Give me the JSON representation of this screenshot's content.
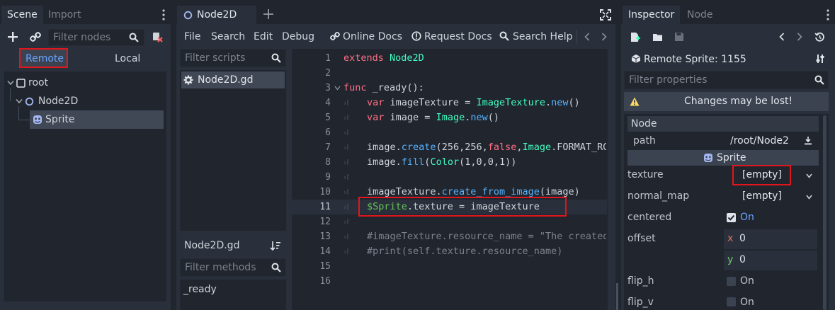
{
  "scene_dock": {
    "tabs": [
      "Scene",
      "Import"
    ],
    "filter_placeholder": "Filter nodes",
    "remote_label": "Remote",
    "local_label": "Local",
    "tree": [
      {
        "label": "root"
      },
      {
        "label": "Node2D"
      },
      {
        "label": "Sprite"
      }
    ]
  },
  "editor": {
    "tab_label": "Node2D",
    "menu": [
      "File",
      "Search",
      "Edit",
      "Debug",
      "Online Docs",
      "Request Docs",
      "Search Help"
    ],
    "filter_scripts_placeholder": "Filter scripts",
    "script_list": [
      "Node2D.gd"
    ],
    "current_script": "Node2D.gd",
    "filter_methods_placeholder": "Filter methods",
    "methods": [
      "_ready"
    ],
    "line_numbers": [
      "1",
      "2",
      "3",
      "4",
      "5",
      "6",
      "7",
      "8",
      "9",
      "10",
      "11",
      "12",
      "13",
      "14",
      "15",
      "16"
    ],
    "code": {
      "l1_kw": "extends",
      "l1_ty": "Node2D",
      "l3_kw": "func",
      "l3_rest": "_ready():",
      "l4_kw": "var",
      "l4_a": "imageTexture = ",
      "l4_ty": "ImageTexture",
      "l4_dot": ".",
      "l4_fn": "new",
      "l4_end": "()",
      "l5_kw": "var",
      "l5_a": "image = ",
      "l5_ty": "Image",
      "l5_dot": ".",
      "l5_fn": "new",
      "l5_end": "()",
      "l7_a": "image.",
      "l7_fn": "create",
      "l7_b": "(256,256,",
      "l7_kw": "false",
      "l7_c": ",",
      "l7_ty": "Image",
      "l7_d": ".FORMAT_RG",
      "l8_a": "image.",
      "l8_fn": "fill",
      "l8_b": "(",
      "l8_ty": "Color",
      "l8_c": "(1,0,0,1))",
      "l10_a": "imageTexture.",
      "l10_fn": "create_from_image",
      "l10_b": "(image)",
      "l11_nd": "$Sprite",
      "l11_rest": ".texture = imageTexture",
      "l13": "#imageTexture.resource_name = \"The created",
      "l14": "#print(self.texture.resource_name)"
    }
  },
  "inspector": {
    "tabs": [
      "Inspector",
      "Node"
    ],
    "object_title": "Remote Sprite: 1155",
    "filter_placeholder": "Filter properties",
    "warning": "Changes may be lost!",
    "section_node": "Node",
    "path_label": "path",
    "path_value": "/root/Node2",
    "section_sprite": "Sprite",
    "texture_label": "texture",
    "texture_value": "[empty]",
    "normal_map_label": "normal_map",
    "normal_map_value": "[empty]",
    "centered_label": "centered",
    "centered_value": "On",
    "offset_label": "offset",
    "offset_x_label": "x",
    "offset_x": "0",
    "offset_y_label": "y",
    "offset_y": "0",
    "flip_h_label": "flip_h",
    "flip_h_value": "On",
    "flip_v_label": "flip_v",
    "flip_v_value": "On"
  }
}
